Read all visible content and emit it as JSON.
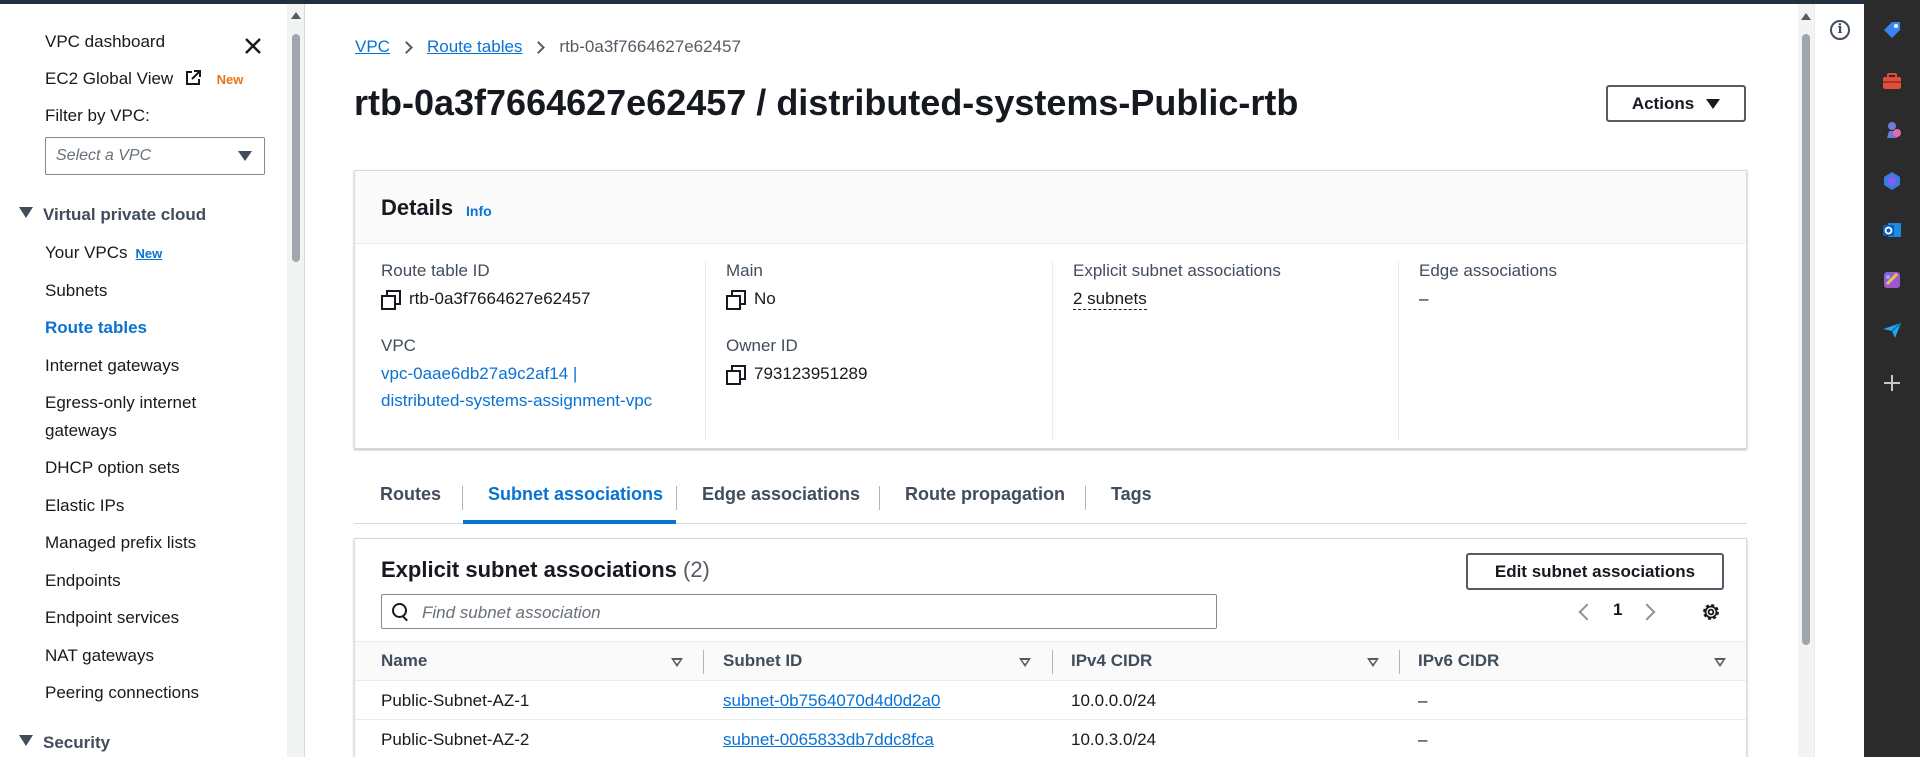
{
  "nav": {
    "dashboard": "VPC dashboard",
    "ec2_global_view": "EC2 Global View",
    "ec2_new_badge": "New",
    "filter_label": "Filter by VPC:",
    "filter_placeholder": "Select a VPC",
    "section_vpc": "Virtual private cloud",
    "items": [
      {
        "label": "Your VPCs",
        "badge": "New"
      },
      {
        "label": "Subnets"
      },
      {
        "label": "Route tables"
      },
      {
        "label": "Internet gateways"
      },
      {
        "label": "Egress-only internet"
      },
      {
        "label": "gateways"
      },
      {
        "label": "DHCP option sets"
      },
      {
        "label": "Elastic IPs"
      },
      {
        "label": "Managed prefix lists"
      },
      {
        "label": "Endpoints"
      },
      {
        "label": "Endpoint services"
      },
      {
        "label": "NAT gateways"
      },
      {
        "label": "Peering connections"
      }
    ],
    "section_security": "Security"
  },
  "breadcrumb": {
    "vpc": "VPC",
    "route_tables": "Route tables",
    "current": "rtb-0a3f7664627e62457"
  },
  "page_title": "rtb-0a3f7664627e62457 / distributed-systems-Public-rtb",
  "actions_label": "Actions",
  "details": {
    "heading": "Details",
    "info": "Info",
    "route_table_id_label": "Route table ID",
    "route_table_id": "rtb-0a3f7664627e62457",
    "vpc_label": "VPC",
    "vpc_value_line1": "vpc-0aae6db27a9c2af14 |",
    "vpc_value_line2": "distributed-systems-assignment-vpc",
    "main_label": "Main",
    "main_value": "No",
    "owner_label": "Owner ID",
    "owner_value": "793123951289",
    "explicit_label": "Explicit subnet associations",
    "explicit_value": "2 subnets",
    "edge_label": "Edge associations",
    "edge_value": "–"
  },
  "tabs": [
    "Routes",
    "Subnet associations",
    "Edge associations",
    "Route propagation",
    "Tags"
  ],
  "table": {
    "title": "Explicit subnet associations",
    "count": "(2)",
    "edit_label": "Edit subnet associations",
    "search_placeholder": "Find subnet association",
    "page": "1",
    "columns": [
      "Name",
      "Subnet ID",
      "IPv4 CIDR",
      "IPv6 CIDR"
    ],
    "rows": [
      {
        "name": "Public-Subnet-AZ-1",
        "subnet_id": "subnet-0b7564070d4d0d2a0",
        "ipv4": "10.0.0.0/24",
        "ipv6": "–"
      },
      {
        "name": "Public-Subnet-AZ-2",
        "subnet_id": "subnet-0065833db7ddc8fca",
        "ipv4": "10.0.3.0/24",
        "ipv6": "–"
      }
    ]
  },
  "colors": {
    "accent": "#0972d3",
    "text": "#16191f",
    "new_badge_orange": "#ec7211",
    "edge_bar": "#2b2b2b"
  },
  "icons": [
    "close-icon",
    "external-link-icon",
    "caret-down-icon",
    "copy-icon",
    "search-icon",
    "chevron-left-icon",
    "chevron-right-icon",
    "gear-icon",
    "info-icon",
    "tag-icon",
    "toolbox-icon",
    "chess-icon",
    "copilot-icon",
    "outlook-icon",
    "designer-icon",
    "send-icon",
    "plus-icon"
  ]
}
